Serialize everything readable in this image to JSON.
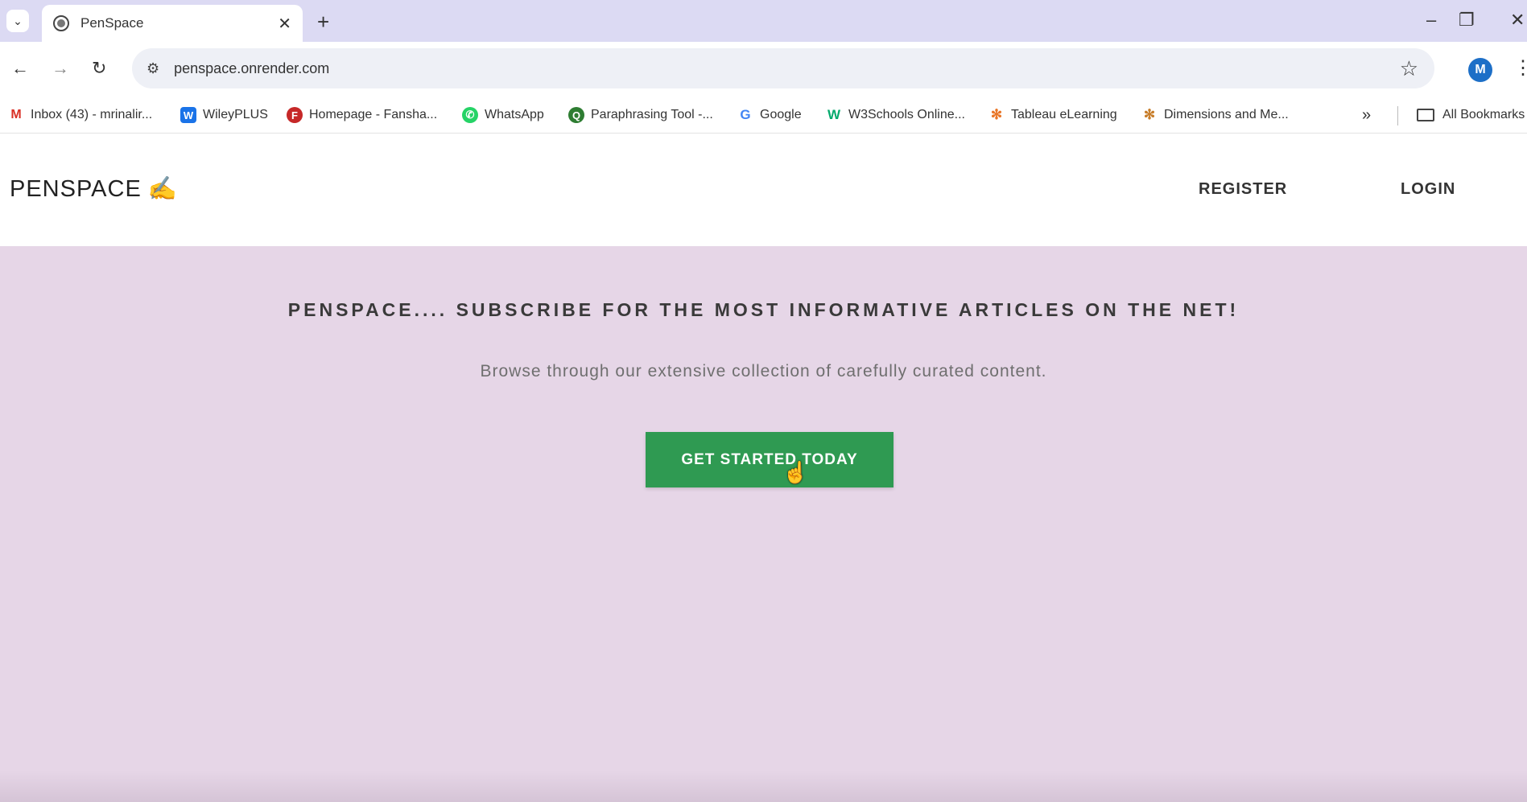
{
  "browser": {
    "tab_title": "PenSpace",
    "tab_close": "✕",
    "new_tab": "+",
    "url": "penspace.onrender.com",
    "avatar_letter": "M",
    "bookmarks": [
      {
        "label": "Inbox (43) - mrinalir...",
        "icon": "gmail-icon",
        "color": "#d93025",
        "glyph": "M"
      },
      {
        "label": "WileyPLUS",
        "icon": "wileyplus-icon",
        "color": "#1a73e8",
        "glyph": "W"
      },
      {
        "label": "Homepage - Fansha...",
        "icon": "fanshawe-icon",
        "color": "#c62828",
        "glyph": "F"
      },
      {
        "label": "WhatsApp",
        "icon": "whatsapp-icon",
        "color": "#25d366",
        "glyph": "✆"
      },
      {
        "label": "Paraphrasing Tool -...",
        "icon": "paraphrase-icon",
        "color": "#2e7d32",
        "glyph": "Q"
      },
      {
        "label": "Google",
        "icon": "google-icon",
        "color": "#4285f4",
        "glyph": "G"
      },
      {
        "label": "W3Schools Online...",
        "icon": "w3schools-icon",
        "color": "#04aa6d",
        "glyph": "W"
      },
      {
        "label": "Tableau eLearning",
        "icon": "tableau-icon",
        "color": "#e97627",
        "glyph": "✻"
      },
      {
        "label": "Dimensions and Me...",
        "icon": "dimensions-icon",
        "color": "#c77d2a",
        "glyph": "✻"
      }
    ],
    "all_bookmarks": "All Bookmarks"
  },
  "site": {
    "brand": "PENSPACE",
    "brand_emoji": "✍",
    "nav": {
      "register": "REGISTER",
      "login": "LOGIN"
    }
  },
  "hero": {
    "heading": "PENSPACE.... SUBSCRIBE FOR THE MOST INFORMATIVE ARTICLES ON THE NET!",
    "subheading": "Browse through our extensive collection of carefully curated content.",
    "cta": "GET STARTED TODAY"
  },
  "colors": {
    "hero_bg": "#e6d6e7",
    "cta_bg": "#2f9a52",
    "chrome_bg": "#dcdaf3"
  }
}
